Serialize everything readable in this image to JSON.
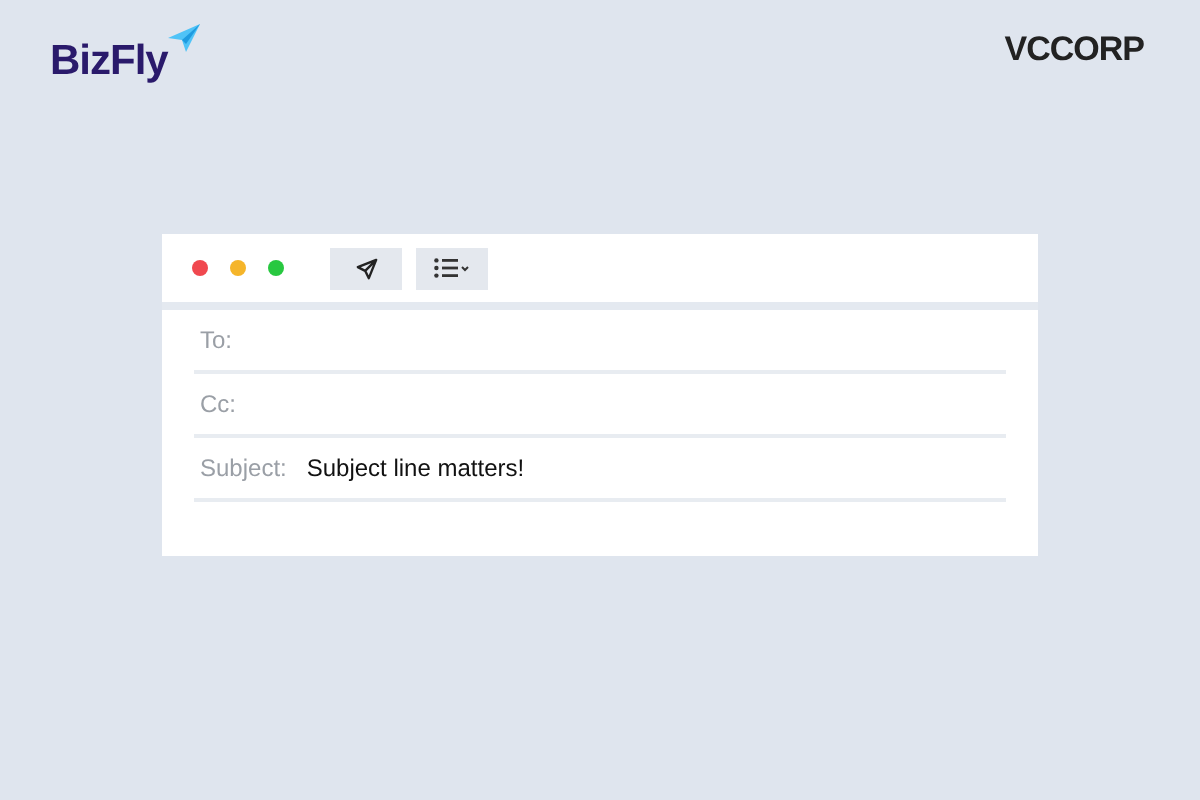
{
  "logos": {
    "left": "BizFly",
    "right": "VCCORP"
  },
  "window": {
    "controls": [
      {
        "color": "#f0484f"
      },
      {
        "color": "#f5b52a"
      },
      {
        "color": "#28c840"
      }
    ]
  },
  "toolbar": {
    "buttons": [
      {
        "kind": "send"
      },
      {
        "kind": "list"
      }
    ]
  },
  "fields": [
    {
      "label": "To:"
    },
    {
      "label": "Cc:"
    },
    {
      "label": "Subject:",
      "value": "Subject line matters!"
    }
  ]
}
